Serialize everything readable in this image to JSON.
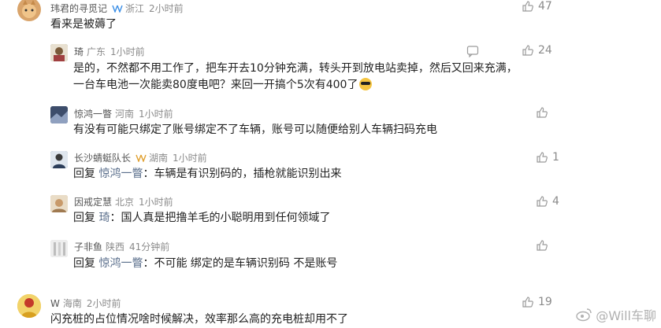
{
  "comments": [
    {
      "user": "玮君的寻觅记",
      "location": "浙江",
      "time": "2小时前",
      "text": "看来是被薅了",
      "likes": "47",
      "avatar_color": "#d9a46b"
    },
    {
      "user": "琦",
      "location": "广东",
      "time": "1小时前",
      "text_line1": "是的，不然都不用工作了，把车开去10分钟充满，转头开到放电站卖掉，然后又回来充满，",
      "text_line2": "一台车电池一次能卖80度电吧？来回一开搞个5次有400了",
      "likes": "24",
      "avatar_color": "#6b7a5a"
    },
    {
      "user": "惊鸿一瞥",
      "location": "河南",
      "time": "1小时前",
      "text": "有没有可能只绑定了账号绑定不了车辆，账号可以随便给别人车辆扫码充电",
      "likes": "",
      "avatar_color": "#4b5b7a"
    },
    {
      "user": "长沙蜻蜓队长",
      "location": "湖南",
      "time": "1小时前",
      "reply_prefix": "回复",
      "reply_target": "惊鸿一瞥",
      "text": "：车辆是有识别码的，插枪就能识别出来",
      "likes": "1",
      "avatar_color": "#3c4f6e"
    },
    {
      "user": "因戒定慧",
      "location": "北京",
      "time": "1小时前",
      "reply_prefix": "回复",
      "reply_target": "琦",
      "text": "：国人真是把撸羊毛的小聪明用到任何领域了",
      "likes": "4",
      "avatar_color": "#b89c7a"
    },
    {
      "user": "子非鱼",
      "location": "陕西",
      "time": "41分钟前",
      "reply_prefix": "回复",
      "reply_target": "惊鸿一瞥",
      "text": "：不可能 绑定的是车辆识别码 不是账号",
      "likes": "",
      "avatar_color": "#c9c9c9"
    },
    {
      "user": "W",
      "location": "海南",
      "time": "2小时前",
      "text": "闪充桩的占位情况啥时候解决，效率那么高的充电桩却用不了",
      "likes": "19",
      "avatar_color": "#e2b23a"
    }
  ],
  "watermark": "@Will车聊",
  "colors": {
    "reply_target": "#5b6f8c",
    "meta": "#8a8a8a",
    "verified": "#3a8ee6"
  }
}
